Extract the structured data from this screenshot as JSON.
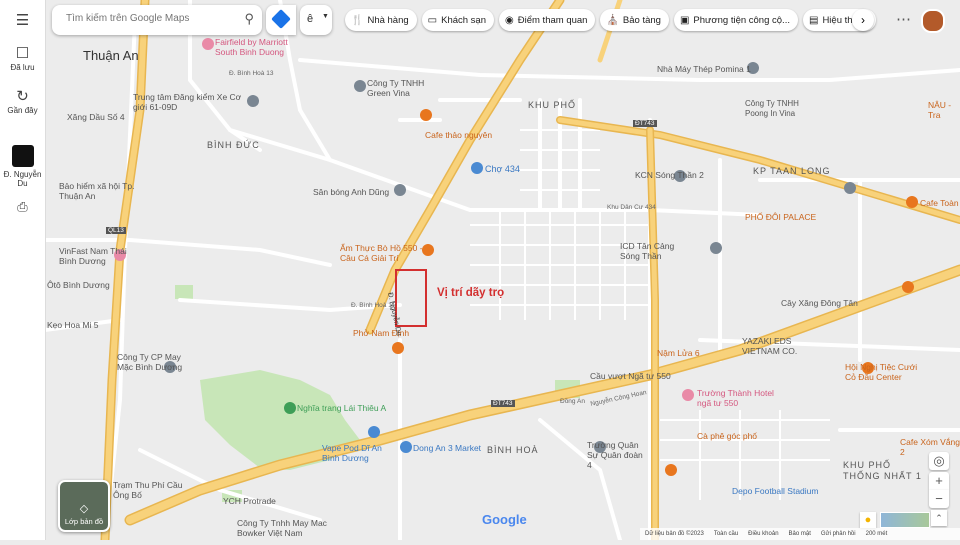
{
  "rail": {
    "saved_label": "Đã lưu",
    "recent_label": "Gần đây",
    "place_label": "Đ. Nguyễn Du"
  },
  "search": {
    "placeholder": "Tìm kiếm trên Google Maps"
  },
  "lang_label": "ê",
  "chips": [
    {
      "icon": "restaurant-icon",
      "label": "Nhà hàng"
    },
    {
      "icon": "hotel-icon",
      "label": "Khách sạn"
    },
    {
      "icon": "camera-icon",
      "label": "Điểm tham quan"
    },
    {
      "icon": "museum-icon",
      "label": "Bảo tàng"
    },
    {
      "icon": "transit-icon",
      "label": "Phương tiện công cộ..."
    },
    {
      "icon": "pharmacy-icon",
      "label": "Hiệu thuốc"
    }
  ],
  "layers_label": "Lớp bản đồ",
  "annotation": "Vị trí dãy trọ",
  "areas": {
    "thuan_an": "Thuận An",
    "binh_duc": "BÌNH ĐỨC",
    "binh_hoa": "BÌNH HOÀ",
    "khu_pho": "KHU PHỐ",
    "kp_taan_long": "KP TAAN LONG",
    "khu_pho_thong_nhat_1": "KHU PHỐ THỐNG NHẤT 1"
  },
  "pois": {
    "fairfield": "Fairfield by Marriott South Binh Duong",
    "trung_tam": "Trung tâm Đăng kiểm Xe Cơ giới 61-09D",
    "green_vina": "Công Ty TNHH Green Vina",
    "cafe_thao": "Cafe thảo nguyên",
    "cho_434": "Chợ 434",
    "pomina": "Nhà Máy Thép Pomina 1",
    "poong_in": "Công Ty TNHH Poong In Vina",
    "xang_dau_so4": "Xăng Dầu Số 4",
    "bao_hiem": "Bảo hiểm xã hội Tp. Thuận An",
    "san_bong": "Sân bóng Anh Dũng",
    "kcn": "KCN Sóng Thần 2",
    "pho_doi": "PHỐ ĐÔI PALACE",
    "cafe_toan": "Cafe Toàn",
    "nau": "NÂU - Tra",
    "vinfast": "VinFast Nam Thái Bình Dương",
    "am_thuc": "Ẩm Thực Bò Hồ 550 - Câu Cá Giải Trí",
    "icd": "ICD Tân Cảng Sóng Thần",
    "oto": "Ôtô Bình Dương",
    "pho_nam_dinh": "Phở Nam Định",
    "cay_xang": "Cây Xăng Đông Tân",
    "yazaki": "YAZAKI EDS VIETNAM CO.",
    "may_mac": "Công Ty CP May Mặc Bình Dương",
    "nam_lua": "Nậm Lửa 6",
    "cau_vuot": "Cầu vượt Ngã tư 550",
    "hoi_nghi": "Hội Nghị Tiệc Cưới Cỏ Đầu Center",
    "truong_thanh": "Trường Thành Hotel ngã tư 550",
    "nghia_trang": "Nghĩa trang Lái Thiêu A",
    "dong_an": "Dong An 3 Market",
    "vape": "Vape Pod Dĩ An Bình Dương",
    "truong_quan_su": "Trường Quân Sự Quân đoàn 4",
    "ca_phe_goc": "Cà phê góc phố",
    "cafe_xom": "Cafe Xóm Vắng 2",
    "depo": "Depo Football Stadium",
    "ych": "YCH Protrade",
    "bowker": "Công Ty Tnhh May Mac Bowker Việt Nam",
    "tam_thu_phi": "Trạm Thu Phí Cầu Ông Bố",
    "hoa_mi": "Kẹo Hoa Mi 5",
    "google": "Google"
  },
  "roads": {
    "nguyen_du": "Đ. Nguyễn Du",
    "dt743": "ĐT743",
    "ql13": "QL13",
    "binh_hoa_11": "Đ. Bình Hoà 11",
    "binh_hoa_13": "Đ. Bình Hoà 13",
    "dan_cu_434": "Khu Dân Cư 434",
    "dong_an": "Đồng An",
    "nguyen_cong_hoan": "Nguyễn Công Hoan"
  },
  "footer": {
    "data": "Dữ liệu bản đồ ©2023",
    "global": "Toàn cầu",
    "terms": "Điều khoản",
    "privacy": "Bảo mật",
    "feedback": "Gửi phản hồi",
    "scale": "200 mét"
  },
  "colors": {
    "major_road": "#f8d27b",
    "major_road_edge": "#e8b650",
    "park": "#c8e6b8",
    "annotation": "#d32f2f",
    "poi_orange": "#e8761e",
    "poi_grey": "#7a8692",
    "poi_blue": "#4a8ad2"
  }
}
